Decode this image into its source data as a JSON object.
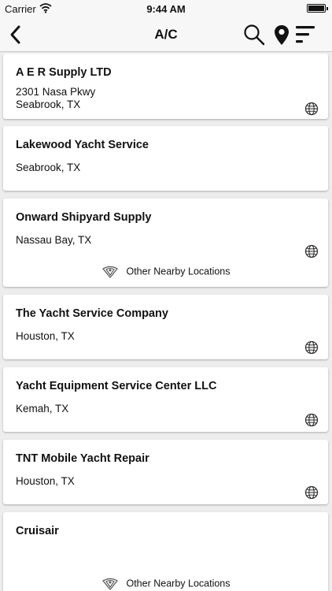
{
  "status_bar": {
    "carrier": "Carrier",
    "time": "9:44 AM"
  },
  "nav": {
    "title": "A/C"
  },
  "listings": [
    {
      "name": "A E R Supply LTD",
      "address_line1": "2301 Nasa Pkwy",
      "address_line2": "Seabrook, TX"
    },
    {
      "name": "Lakewood Yacht Service",
      "address_line1": "Seabrook, TX"
    },
    {
      "name": "Onward Shipyard Supply",
      "address_line1": "Nassau Bay, TX",
      "nearby_label": "Other Nearby Locations"
    },
    {
      "name": "The Yacht Service Company",
      "address_line1": "Houston, TX"
    },
    {
      "name": "Yacht Equipment Service Center LLC",
      "address_line1": "Kemah, TX"
    },
    {
      "name": "TNT Mobile Yacht Repair",
      "address_line1": "Houston, TX"
    },
    {
      "name": "Cruisair",
      "nearby_label": "Other Nearby Locations"
    }
  ],
  "icons": {
    "back": "chevron-left-icon",
    "search": "search-icon",
    "location": "map-pin-icon",
    "sort": "sort-menu-icon",
    "website": "globe-icon",
    "nearby": "nearby-locations-icon"
  }
}
